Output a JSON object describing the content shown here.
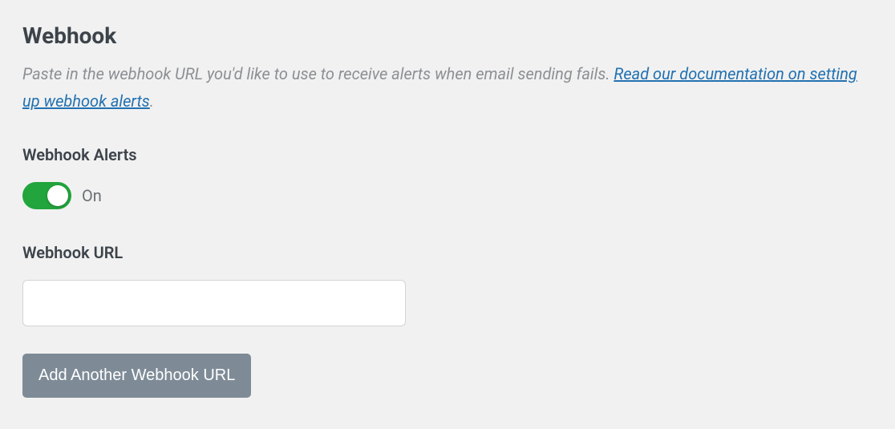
{
  "section": {
    "title": "Webhook",
    "description_prefix": "Paste in the webhook URL you'd like to use to receive alerts when email sending fails. ",
    "doc_link_text": "Read our documentation on setting up webhook alerts",
    "description_suffix": "."
  },
  "alerts": {
    "label": "Webhook Alerts",
    "state_text": "On"
  },
  "url": {
    "label": "Webhook URL",
    "value": ""
  },
  "add_button": {
    "label": "Add Another Webhook URL"
  }
}
